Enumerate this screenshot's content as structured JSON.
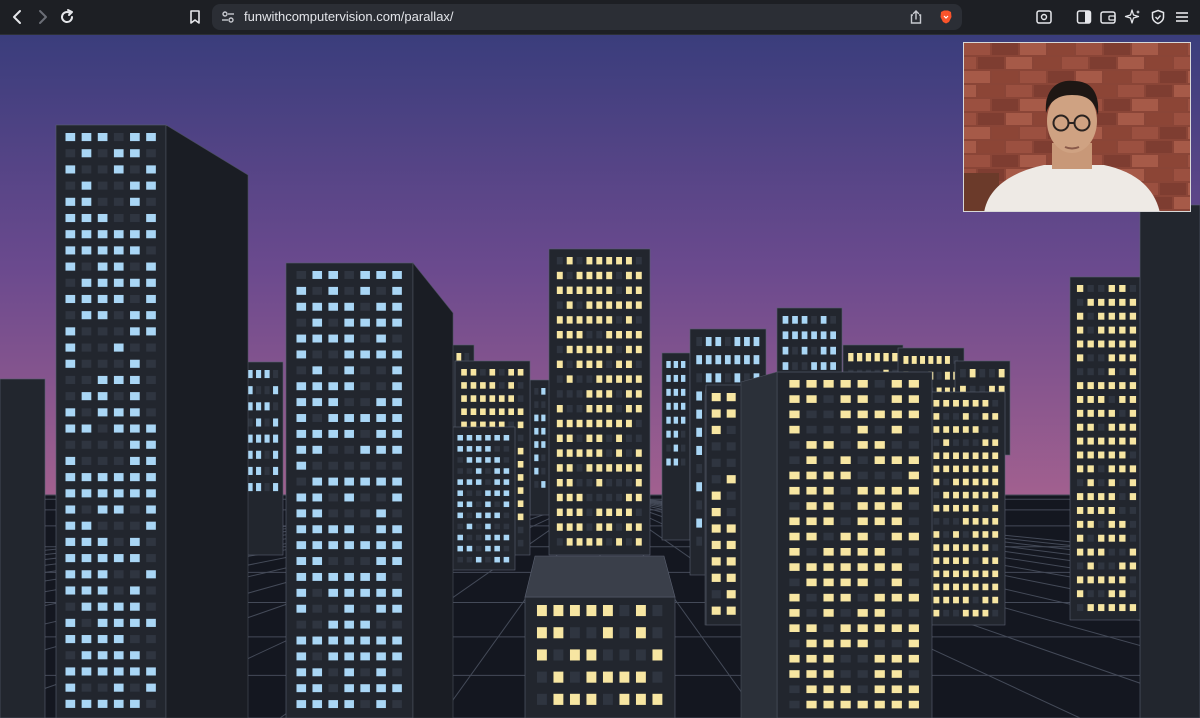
{
  "browser": {
    "url": "funwithcomputervision.com/parallax/",
    "icons": {
      "back": "chevron-left-icon",
      "forward": "chevron-right-icon",
      "reload": "reload-icon",
      "bookmark": "bookmark-icon",
      "site_settings": "site-settings-icon",
      "share": "share-icon",
      "brave_shields": "brave-lion-icon",
      "screenshot": "screenshot-icon",
      "sidebar": "sidebar-icon",
      "wallet": "wallet-icon",
      "leo": "sparkle-icon",
      "vpn": "shield-icon",
      "menu": "hamburger-menu-icon"
    }
  },
  "scene": {
    "sky_colors": [
      "#3a3d7c",
      "#6b4a8e",
      "#b0668f"
    ],
    "window_cool": "#a9d6f5",
    "window_warm": "#f7e6a2",
    "building_color": "#23272f"
  },
  "webcam": {
    "subject": "person-with-glasses",
    "background": "brick-wall"
  }
}
